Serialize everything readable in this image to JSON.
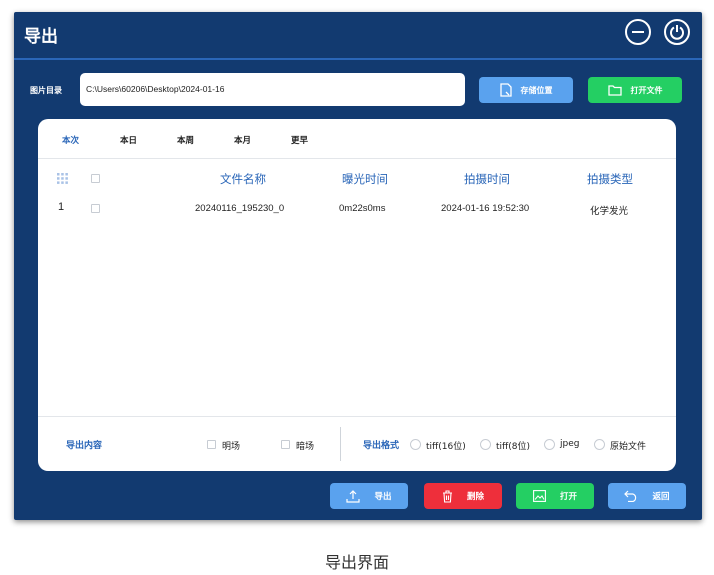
{
  "window": {
    "title": "导出"
  },
  "directory": {
    "label": "图片目录",
    "path": "C:\\Users\\60206\\Desktop\\2024-01-16"
  },
  "buttons": {
    "save_location": "存储位置",
    "open_file": "打开文件"
  },
  "tabs": [
    {
      "label": "本次",
      "active": true
    },
    {
      "label": "本日",
      "active": false
    },
    {
      "label": "本周",
      "active": false
    },
    {
      "label": "本月",
      "active": false
    },
    {
      "label": "更早",
      "active": false
    }
  ],
  "table": {
    "columns": [
      "文件名称",
      "曝光时间",
      "拍摄时间",
      "拍摄类型"
    ],
    "rows": [
      {
        "index": "1",
        "file_name": "20240116_195230_0",
        "exposure": "0m22s0ms",
        "shot_time": "2024-01-16 19:52:30",
        "shot_type": "化学发光"
      }
    ]
  },
  "export_content": {
    "label": "导出内容",
    "options": [
      "明场",
      "暗场"
    ]
  },
  "export_format": {
    "label": "导出格式",
    "options": [
      "tiff(16位)",
      "tiff(8位)",
      "jpeg",
      "原始文件"
    ]
  },
  "actions": {
    "export": "导出",
    "delete": "删除",
    "open": "打开",
    "back": "返回"
  },
  "caption": "导出界面",
  "colors": {
    "window_bg": "#123a70",
    "accent_blue": "#5aa2ee",
    "green": "#24cf63",
    "red": "#ee2f3b",
    "header_text": "#2a66b8"
  }
}
